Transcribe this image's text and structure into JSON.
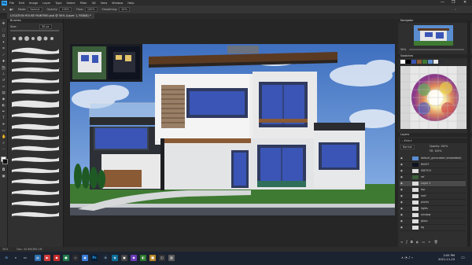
{
  "app": {
    "logo": "Ps",
    "menus": [
      "File",
      "Edit",
      "Image",
      "Layer",
      "Type",
      "Select",
      "Filter",
      "3D",
      "View",
      "Window",
      "Help"
    ],
    "window_controls": [
      "—",
      "❐",
      "✕"
    ]
  },
  "options_bar": {
    "items": [
      {
        "label": "Mode:",
        "value": "Normal"
      },
      {
        "label": "Opacity:",
        "value": "100%"
      },
      {
        "label": "Flow:",
        "value": "100%"
      },
      {
        "label": "Smoothing:",
        "value": "10%"
      }
    ]
  },
  "document": {
    "tab_title": "LOCATION HOUSE PAINTING.psd @ 50% (Layer 1, RGB/8) *",
    "zoom": "50%",
    "status": "Doc: 45.9M/389.1M"
  },
  "brush_panel": {
    "title": "Brushes",
    "size_label": "Size:",
    "size_value": "30 px"
  },
  "navigator": {
    "title": "Navigator",
    "zoom": "50%"
  },
  "swatches": {
    "title": "Swatches"
  },
  "layers": {
    "title": "Layers",
    "blend_mode": "Normal",
    "opacity_label": "Opacity:",
    "opacity_value": "100%",
    "fill_label": "Fill:",
    "fill_value": "100%",
    "items": [
      {
        "name": "default_generated (embedded)"
      },
      {
        "name": "NIGHT"
      },
      {
        "name": "SKETCH"
      },
      {
        "name": "ref"
      },
      {
        "name": "Layer 1"
      },
      {
        "name": "top"
      },
      {
        "name": "roof"
      },
      {
        "name": "plants"
      },
      {
        "name": "lights"
      },
      {
        "name": "window"
      },
      {
        "name": "glass"
      },
      {
        "name": "bg"
      }
    ]
  },
  "taskbar": {
    "time": "2:05 PM",
    "date": "2021-11-23"
  },
  "colors": {
    "accent": "#31a8ff",
    "panel_bg": "#2f2f2f",
    "sky": "#5a8dd0",
    "roof": "#5b3a22",
    "grass": "#3f7a33",
    "glass": "#3a55b5"
  }
}
